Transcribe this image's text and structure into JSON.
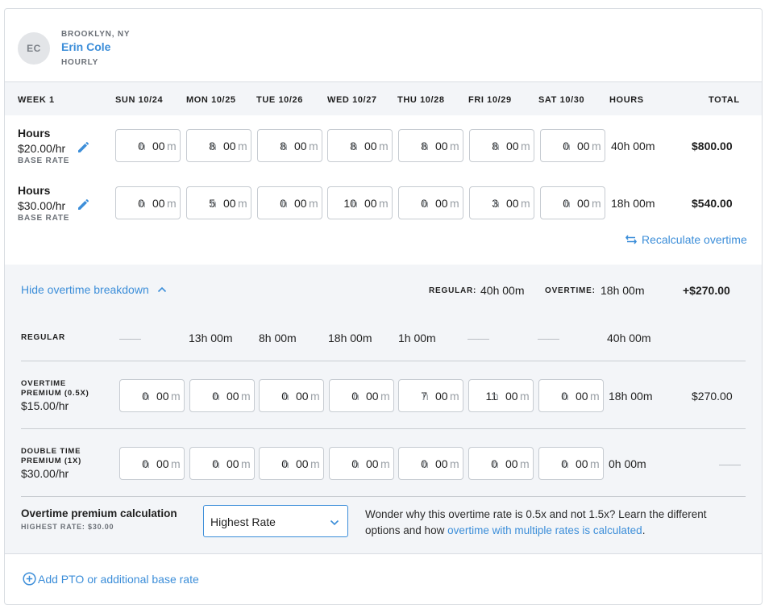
{
  "employee": {
    "initials": "EC",
    "location": "BROOKLYN, NY",
    "name": "Erin Cole",
    "type": "HOURLY"
  },
  "header": {
    "week": "WEEK 1",
    "days": [
      "SUN 10/24",
      "MON 10/25",
      "TUE 10/26",
      "WED 10/27",
      "THU 10/28",
      "FRI 10/29",
      "SAT 10/30"
    ],
    "hours": "HOURS",
    "total": "TOTAL"
  },
  "rows": [
    {
      "label": "Hours",
      "rate": "$20.00/hr",
      "rate_type": "BASE RATE",
      "entries": [
        [
          "0",
          "00"
        ],
        [
          "8",
          "00"
        ],
        [
          "8",
          "00"
        ],
        [
          "8",
          "00"
        ],
        [
          "8",
          "00"
        ],
        [
          "8",
          "00"
        ],
        [
          "0",
          "00"
        ]
      ],
      "hours": "40h 00m",
      "total": "$800.00"
    },
    {
      "label": "Hours",
      "rate": "$30.00/hr",
      "rate_type": "BASE RATE",
      "entries": [
        [
          "0",
          "00"
        ],
        [
          "5",
          "00"
        ],
        [
          "0",
          "00"
        ],
        [
          "10",
          "00"
        ],
        [
          "0",
          "00"
        ],
        [
          "3",
          "00"
        ],
        [
          "0",
          "00"
        ]
      ],
      "hours": "18h 00m",
      "total": "$540.00"
    }
  ],
  "units": {
    "h": "h",
    "m": "m"
  },
  "recalculate": "Recalculate overtime",
  "breakdown": {
    "toggle": "Hide overtime breakdown",
    "regular_label": "REGULAR:",
    "regular_value": "40h 00m",
    "overtime_label": "OVERTIME:",
    "overtime_value": "18h 00m",
    "overtime_total": "+$270.00",
    "regular_row": {
      "label": "REGULAR",
      "days": [
        "——",
        "13h 00m",
        "8h 00m",
        "18h 00m",
        "1h 00m",
        "——",
        "——"
      ],
      "hours": "40h 00m"
    },
    "ot_row": {
      "label_line1": "OVERTIME",
      "label_line2": "PREMIUM (0.5X)",
      "rate": "$15.00/hr",
      "entries": [
        [
          "0",
          "00"
        ],
        [
          "0",
          "00"
        ],
        [
          "0",
          "00"
        ],
        [
          "0",
          "00"
        ],
        [
          "7",
          "00"
        ],
        [
          "11",
          "00"
        ],
        [
          "0",
          "00"
        ]
      ],
      "hours": "18h 00m",
      "total": "$270.00"
    },
    "dt_row": {
      "label_line1": "DOUBLE TIME",
      "label_line2": "PREMIUM (1X)",
      "rate": "$30.00/hr",
      "entries": [
        [
          "0",
          "00"
        ],
        [
          "0",
          "00"
        ],
        [
          "0",
          "00"
        ],
        [
          "0",
          "00"
        ],
        [
          "0",
          "00"
        ],
        [
          "0",
          "00"
        ],
        [
          "0",
          "00"
        ]
      ],
      "hours": "0h 00m",
      "total": "——"
    }
  },
  "premium_calc": {
    "title": "Overtime premium calculation",
    "subtitle": "HIGHEST RATE: $30.00",
    "selected": "Highest Rate",
    "info_text": "Wonder why this overtime rate is 0.5x and not 1.5x? Learn the different options and how",
    "info_link": "overtime with multiple rates is calculated",
    "info_end": "."
  },
  "add_pto": "Add PTO or additional base rate",
  "colors": {
    "accent": "#3c8ed9",
    "panel": "#f3f5f8"
  }
}
